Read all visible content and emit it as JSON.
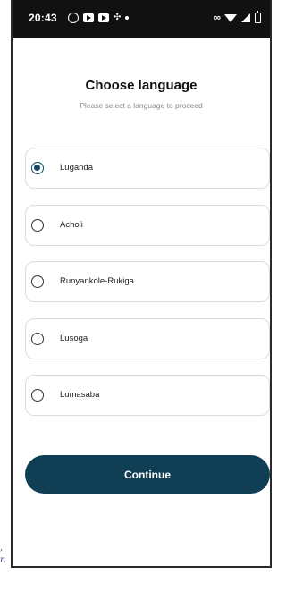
{
  "status_bar": {
    "time": "20:43"
  },
  "header": {
    "title": "Choose language",
    "subtitle": "Please select a language to proceed"
  },
  "languages": [
    {
      "label": "Luganda",
      "selected": true
    },
    {
      "label": "Acholi",
      "selected": false
    },
    {
      "label": "Runyankole-Rukiga",
      "selected": false
    },
    {
      "label": "Lusoga",
      "selected": false
    },
    {
      "label": "Lumasaba",
      "selected": false
    }
  ],
  "continue_label": "Continue",
  "margin_marks": [
    ",",
    "r."
  ],
  "colors": {
    "accent": "#0f3e55",
    "status_bar": "#111111",
    "border": "#dcdcdc"
  }
}
